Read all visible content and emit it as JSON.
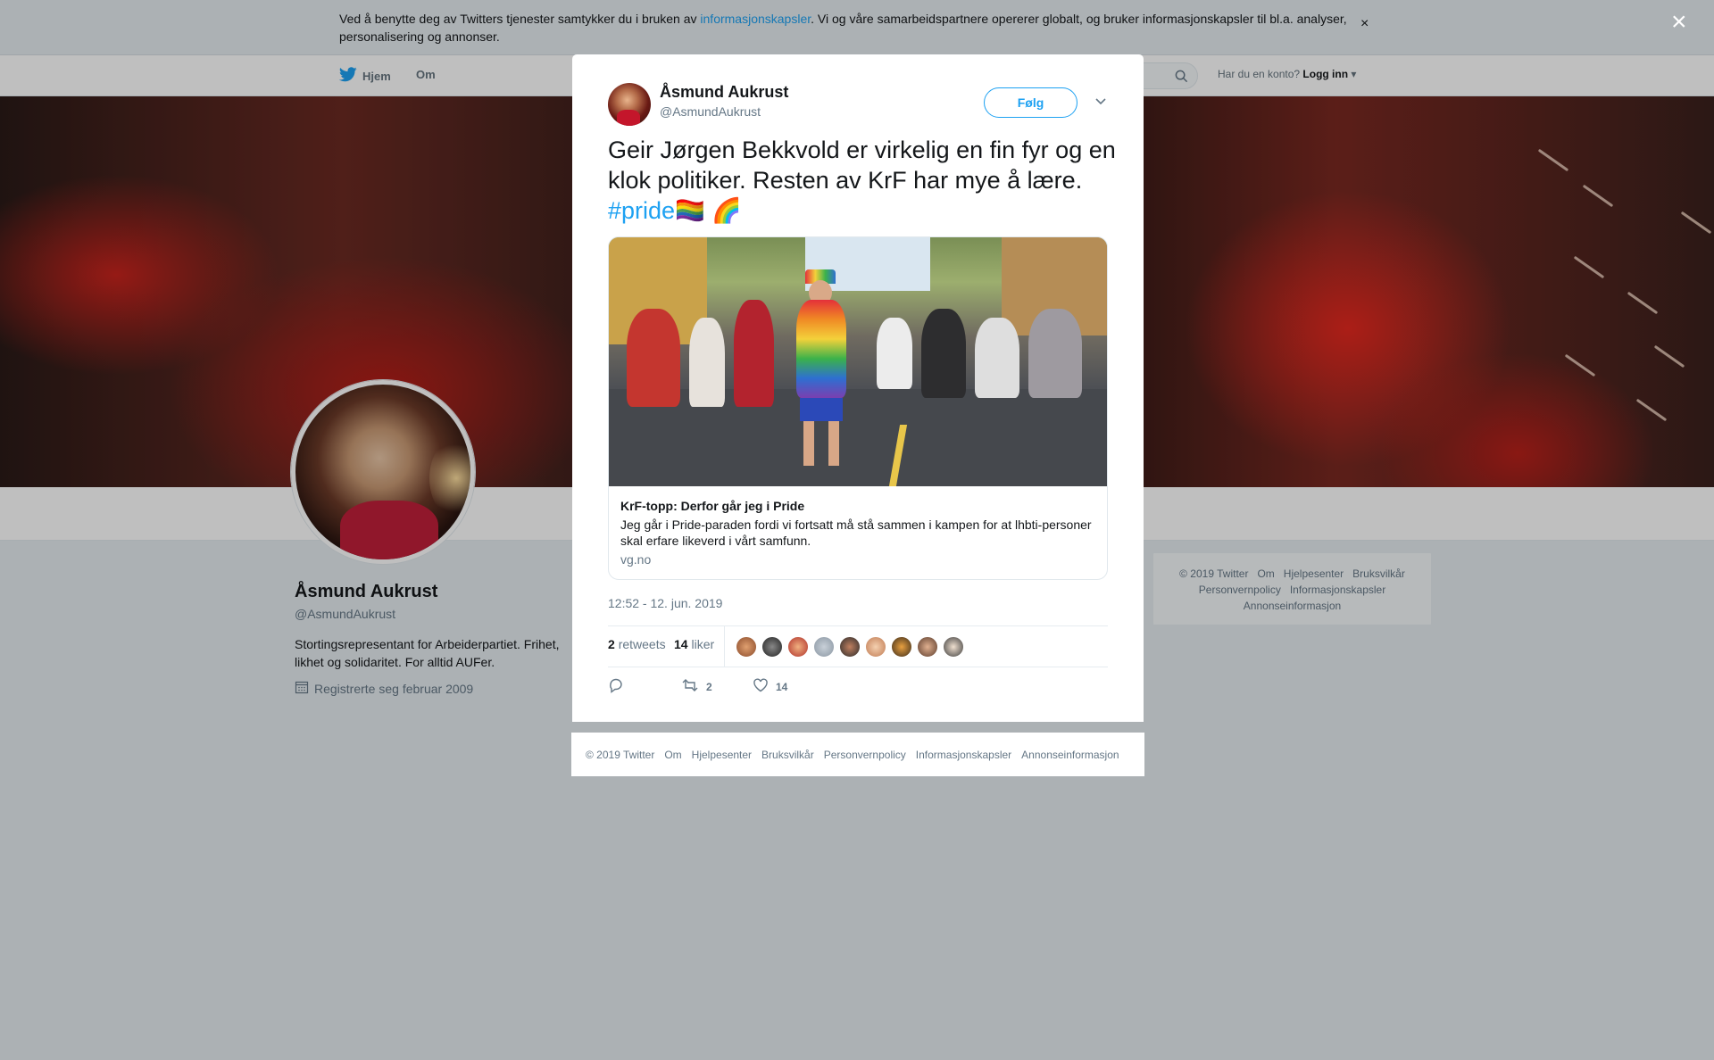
{
  "cookie_bar": {
    "text_before": "Ved å benytte deg av Twitters tjenester samtykker du i bruken av ",
    "link": "informasjonskapsler",
    "text_after": ". Vi og våre samarbeidspartnere opererer globalt, og bruker informasjonskapsler til bl.a. analyser, personalisering og annonser.",
    "close": "×"
  },
  "nav": {
    "home": "Hjem",
    "about": "Om",
    "login_prompt": "Har du en konto?",
    "login": "Logg inn"
  },
  "profile": {
    "name": "Åsmund Aukrust",
    "handle": "@AsmundAukrust",
    "bio": "Stortingsrepresentant for Arbeiderpartiet. Frihet, likhet og solidaritet. For alltid AUFer.",
    "joined": "Registrerte seg februar 2009"
  },
  "side_footer": {
    "items": [
      "© 2019 Twitter",
      "Om",
      "Hjelpesenter",
      "Bruksvilkår",
      "Personvernpolicy",
      "Informasjonskapsler",
      "Annonseinformasjon"
    ]
  },
  "modal": {
    "close": "×",
    "author": {
      "name": "Åsmund Aukrust",
      "handle": "@AsmundAukrust"
    },
    "follow_label": "Følg",
    "tweet_text": "Geir Jørgen Bekkvold er virkelig en fin fyr og en klok politiker. Resten av KrF har mye å lære. ",
    "hashtag": "#pride",
    "emoji": "🏳️‍🌈 🌈",
    "card": {
      "title": "KrF-topp: Derfor går jeg i Pride",
      "description": "Jeg går i Pride-paraden fordi vi fortsatt må stå sammen i kampen for at lhbti-personer skal erfare likeverd i vårt samfunn.",
      "domain": "vg.no"
    },
    "timestamp": "12:52 - 12. jun. 2019",
    "stats": {
      "retweets_count": "2",
      "retweets_label": "retweets",
      "likes_count": "14",
      "likes_label": "liker"
    },
    "actions": {
      "retweet_count": "2",
      "like_count": "14"
    }
  },
  "bottom_footer": {
    "items": [
      "© 2019 Twitter",
      "Om",
      "Hjelpesenter",
      "Bruksvilkår",
      "Personvernpolicy",
      "Informasjonskapsler",
      "Annonseinformasjon"
    ]
  },
  "colors": {
    "accent": "#1da1f2",
    "background": "#e6ecf0",
    "muted_text": "#657786"
  }
}
